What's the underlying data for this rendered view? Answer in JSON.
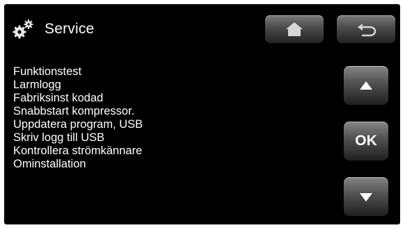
{
  "header": {
    "icon": "gears-icon",
    "title": "Service",
    "home_button_icon": "home-arrow-icon",
    "back_button_icon": "back-arrow-icon"
  },
  "menu": {
    "items": [
      "Funktionstest",
      "Larmlogg",
      "Fabriksinst kodad",
      "Snabbstart kompressor.",
      "Uppdatera program, USB",
      "Skriv logg till USB",
      "Kontrollera strömkännare",
      "Ominstallation"
    ]
  },
  "nav": {
    "up_icon": "up-arrow-icon",
    "ok_label": "OK",
    "down_icon": "down-arrow-icon"
  },
  "colors": {
    "background": "#000000",
    "text": "#ffffff",
    "button_top": "#858585",
    "button_bottom": "#1e1e1e"
  }
}
